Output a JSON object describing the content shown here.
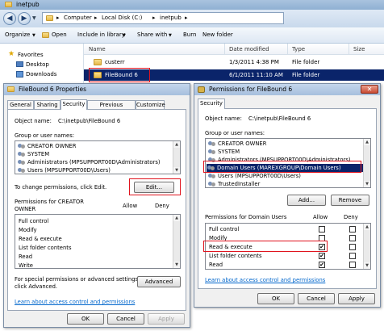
{
  "explorer": {
    "title": "inetpub",
    "address": {
      "seg1": "Computer",
      "seg2": "Local Disk (C:)",
      "seg3": "inetpub"
    },
    "commands": {
      "organize": "Organize",
      "open": "Open",
      "include": "Include in library",
      "share": "Share with",
      "burn": "Burn",
      "new_folder": "New folder"
    },
    "nav": {
      "favorites": "Favorites",
      "desktop": "Desktop",
      "downloads": "Downloads"
    },
    "columns": {
      "name": "Name",
      "date": "Date modified",
      "type": "Type",
      "size": "Size"
    },
    "rows": [
      {
        "name": "custerr",
        "date": "1/3/2011 4:38 PM",
        "type": "File folder"
      },
      {
        "name": "FileBound 6",
        "date": "6/1/2011 11:10 AM",
        "type": "File folder"
      }
    ]
  },
  "props": {
    "title": "FileBound 6 Properties",
    "tabs": [
      "General",
      "Sharing",
      "Security",
      "Previous Versions",
      "Customize"
    ],
    "object_label": "Object name:",
    "object_value": "C:\\inetpub\\FileBound 6",
    "group_label": "Group or user names:",
    "groups": [
      "CREATOR OWNER",
      "SYSTEM",
      "Administrators (MPSUPPORT00D\\Administrators)",
      "Users (MPSUPPORT00D\\Users)"
    ],
    "change_text": "To change permissions, click Edit.",
    "edit_button": "Edit...",
    "perm_header": "Permissions for CREATOR\nOWNER",
    "perm_header_1": "Permissions for CREATOR",
    "perm_header_2": "OWNER",
    "allow": "Allow",
    "deny": "Deny",
    "perms": [
      "Full control",
      "Modify",
      "Read & execute",
      "List folder contents",
      "Read",
      "Write"
    ],
    "special_text_1": "For special permissions or advanced settings,",
    "special_text_2": "click Advanced.",
    "advanced_button": "Advanced",
    "learn_link": "Learn about access control and permissions",
    "ok": "OK",
    "cancel": "Cancel",
    "apply": "Apply"
  },
  "perms_dialog": {
    "title": "Permissions for FileBound 6",
    "tab": "Security",
    "object_label": "Object name:",
    "object_value": "C:\\inetpub\\FileBound 6",
    "group_label": "Group or user names:",
    "groups": [
      "CREATOR OWNER",
      "SYSTEM",
      "Administrators (MPSUPPORT00D\\Administrators)",
      "Domain Users (MAREXGROUP\\Domain Users)",
      "Users (MPSUPPORT00D\\Users)",
      "TrustedInstaller"
    ],
    "add_button": "Add...",
    "remove_button": "Remove",
    "perm_header": "Permissions for Domain Users",
    "allow": "Allow",
    "deny": "Deny",
    "perms": [
      "Full control",
      "Modify",
      "Read & execute",
      "List folder contents",
      "Read"
    ],
    "allow_checked": [
      false,
      false,
      true,
      true,
      true
    ],
    "learn_link": "Learn about access control and permissions",
    "ok": "OK",
    "cancel": "Cancel",
    "apply": "Apply"
  },
  "colors": {
    "highlight": "#0a246a",
    "callout": "#e0141e",
    "link": "#0066cc"
  }
}
